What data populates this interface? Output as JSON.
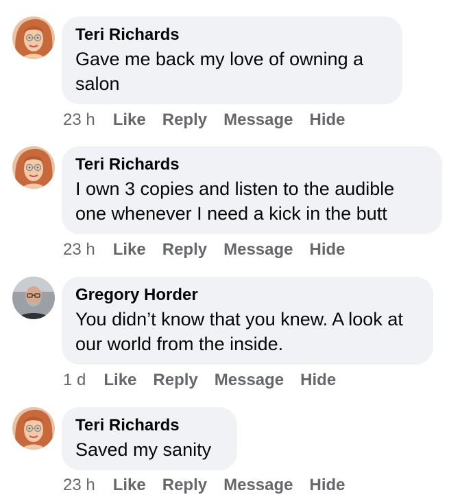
{
  "comments": [
    {
      "author": "Teri Richards",
      "text": "Gave me back my love of owning a salon",
      "time": "23 h",
      "actions": {
        "like": "Like",
        "reply": "Reply",
        "message": "Message",
        "hide": "Hide"
      },
      "avatar": "woman-avatar"
    },
    {
      "author": "Teri Richards",
      "text": "I own 3 copies and listen to the audible one whenever I need a kick in the butt",
      "time": "23 h",
      "actions": {
        "like": "Like",
        "reply": "Reply",
        "message": "Message",
        "hide": "Hide"
      },
      "avatar": "woman-avatar"
    },
    {
      "author": "Gregory Horder",
      "text": "You didn’t know that you knew. A look at our world from the inside.",
      "time": "1 d",
      "actions": {
        "like": "Like",
        "reply": "Reply",
        "message": "Message",
        "hide": "Hide"
      },
      "avatar": "man-avatar"
    },
    {
      "author": "Teri Richards",
      "text": "Saved my sanity",
      "time": "23 h",
      "actions": {
        "like": "Like",
        "reply": "Reply",
        "message": "Message",
        "hide": "Hide"
      },
      "avatar": "woman-avatar"
    }
  ],
  "colors": {
    "bubble": "#f0f2f5",
    "meta": "#65676b",
    "text": "#050505"
  }
}
